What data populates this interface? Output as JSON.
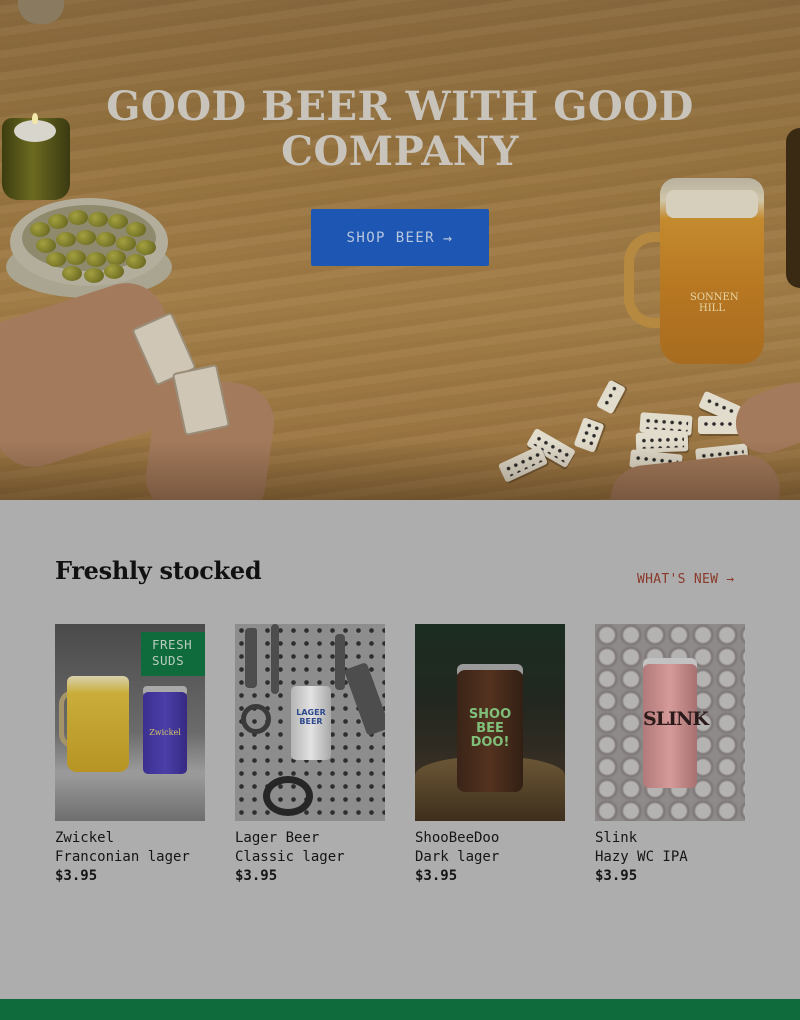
{
  "hero": {
    "title": "GOOD BEER WITH GOOD COMPANY",
    "button_label": "SHOP BEER",
    "button_icon": "arrow-right-icon",
    "mug_logo": "SONNEN HILL"
  },
  "section": {
    "title": "Freshly stocked",
    "link_label": "WHAT'S NEW",
    "link_icon": "arrow-right-icon"
  },
  "products": [
    {
      "name": "Zwickel",
      "style": "Franconian lager",
      "price": "$3.95",
      "badge": "FRESH SUDS",
      "can_text": "Zwickel"
    },
    {
      "name": "Lager Beer",
      "style": "Classic lager",
      "price": "$3.95",
      "can_text": "LAGER BEER"
    },
    {
      "name": "ShooBeeDoo",
      "style": "Dark lager",
      "price": "$3.95",
      "can_text": "SHOO BEE DOO!"
    },
    {
      "name": "Slink",
      "style": "Hazy WC IPA",
      "price": "$3.95",
      "can_text": "SLINK"
    }
  ],
  "colors": {
    "primary_button": "#1d57b3",
    "badge": "#0f6b3c",
    "link": "#8a3a2a",
    "footer": "#0f6b3c"
  }
}
